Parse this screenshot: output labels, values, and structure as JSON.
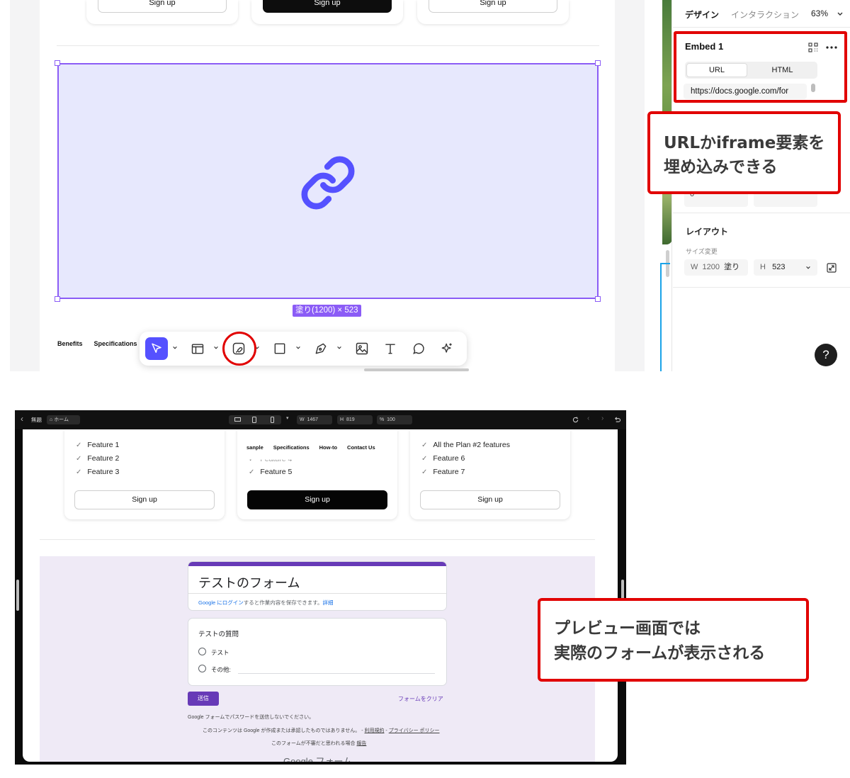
{
  "editor": {
    "pricing_buttons": [
      "Sign up",
      "Sign up",
      "Sign up"
    ],
    "size_badge": "塗り(1200) × 523",
    "nav_labels": [
      "Benefits",
      "Specifications"
    ],
    "toolbar": {
      "tools": [
        "move-tool",
        "frame-tool",
        "embed-tool",
        "shape-tool",
        "pen-tool",
        "image-tool",
        "text-tool",
        "comment-tool",
        "ai-tool"
      ],
      "active": "move-tool",
      "highlighted": "embed-tool",
      "accent": "#5551ff"
    }
  },
  "panel": {
    "tabs": [
      "デザイン",
      "インタラクション"
    ],
    "zoom": "63%",
    "embed": {
      "title": "Embed 1",
      "segments": [
        "URL",
        "HTML"
      ],
      "selected_segment": "URL",
      "url_value": "https://docs.google.com/for"
    },
    "partial_value": "0",
    "layout_title": "レイアウト",
    "resize_label": "サイズ変更",
    "w_label": "W",
    "w_value": "1200",
    "w_mode": "塗り",
    "h_label": "H",
    "h_value": "523",
    "help": "?"
  },
  "callouts": {
    "first": "URLかiframe要素を\n埋め込みできる",
    "second": "プレビュー画面では\n実際のフォームが表示される",
    "color": "#e10000"
  },
  "preview": {
    "back": "‹",
    "file_name": "無題",
    "home_label": "ホーム",
    "width_label": "W",
    "width_value": "1467",
    "height_label": "H",
    "height_value": "819",
    "zoom_label": "%",
    "zoom_value": "100",
    "cards": [
      {
        "features": [
          "Feature 1",
          "Feature 2",
          "Feature 3"
        ],
        "button": "Sign up"
      },
      {
        "features": [
          "Feature 4",
          "Feature 5"
        ],
        "button": "Sign up"
      },
      {
        "features": [
          "All the Plan #2 features",
          "Feature 6",
          "Feature 7"
        ],
        "button": "Sign up"
      }
    ],
    "nav": [
      "sanple",
      "Specifications",
      "How-to",
      "Contact Us"
    ],
    "form": {
      "title": "テストのフォーム",
      "login_link": "Google にログイン",
      "login_rest": "すると作業内容を保存できます。",
      "login_detail": "詳細",
      "question": "テストの質問",
      "options": [
        "テスト",
        "その他:"
      ],
      "submit": "送信",
      "clear": "フォームをクリア",
      "note_password": "Google フォームでパスワードを送信しないでください。",
      "note_content": "このコンテンツは Google が作成または承認したものではありません。 - ",
      "terms": "利用規約",
      "sep": " - ",
      "privacy": "プライバシー ポリシー",
      "report_pre": "このフォームが不審だと思われる場合",
      "report_link": "報告",
      "brand": "Google フォーム",
      "accent": "#673ab7"
    }
  }
}
